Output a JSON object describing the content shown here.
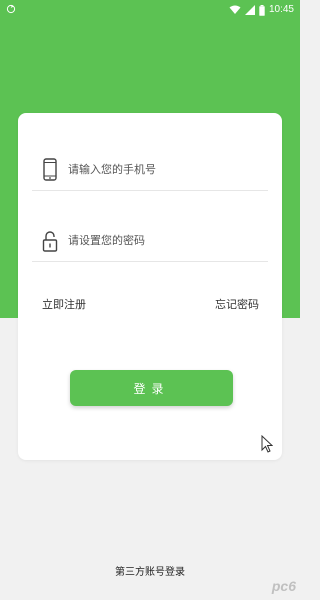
{
  "colors": {
    "brand": "#5cc253",
    "background": "#f1f1f1",
    "card": "#ffffff"
  },
  "statusbar": {
    "time": "10:45",
    "icons": [
      "wifi-icon",
      "signal-icon",
      "battery-icon"
    ]
  },
  "login_form": {
    "phone": {
      "icon": "phone-icon",
      "placeholder": "请输入您的手机号",
      "value": ""
    },
    "password": {
      "icon": "lock-icon",
      "placeholder": "请设置您的密码",
      "value": ""
    },
    "register_link": "立即注册",
    "forgot_link": "忘记密码",
    "login_button": "登录"
  },
  "footer": {
    "third_party_login": "第三方账号登录",
    "watermark": "pc6"
  }
}
